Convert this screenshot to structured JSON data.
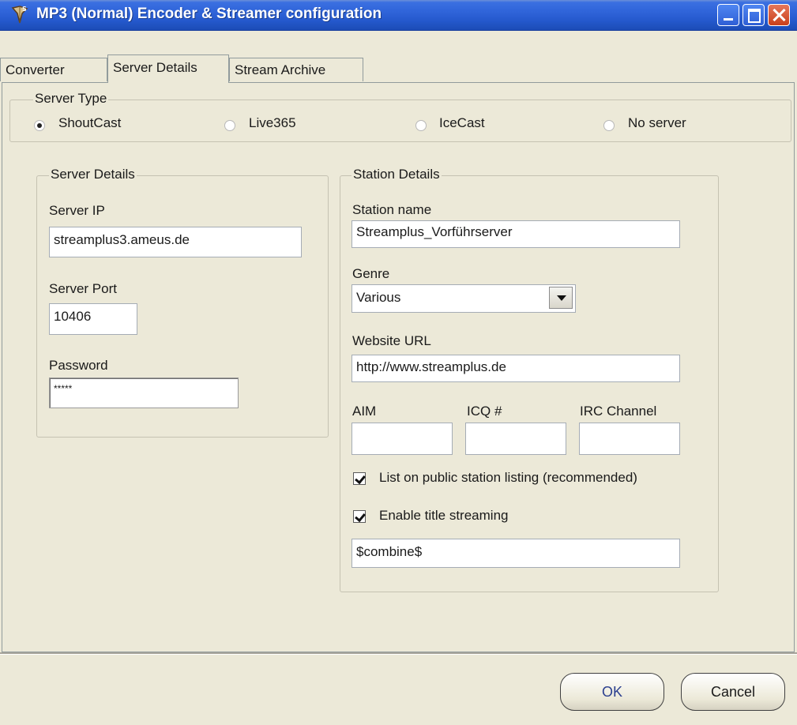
{
  "window": {
    "title": "MP3 (Normal) Encoder & Streamer configuration",
    "accent_color": "#2458cc",
    "close_color": "#c9401b"
  },
  "tabs": [
    {
      "label": "Converter",
      "active": false
    },
    {
      "label": "Server Details",
      "active": true
    },
    {
      "label": "Stream Archive",
      "active": false
    }
  ],
  "server_type": {
    "legend": "Server Type",
    "options": [
      {
        "label": "ShoutCast",
        "selected": true
      },
      {
        "label": "Live365",
        "selected": false
      },
      {
        "label": "IceCast",
        "selected": false
      },
      {
        "label": "No server",
        "selected": false
      }
    ]
  },
  "server_details": {
    "legend": "Server Details",
    "ip_label": "Server IP",
    "ip_value": "streamplus3.ameus.de",
    "port_label": "Server Port",
    "port_value": "10406",
    "password_label": "Password",
    "password_value": "*****"
  },
  "station_details": {
    "legend": "Station Details",
    "name_label": "Station name",
    "name_value": "Streamplus_Vorführserver",
    "genre_label": "Genre",
    "genre_value": "Various",
    "website_label": "Website URL",
    "website_value": "http://www.streamplus.de",
    "aim_label": "AIM",
    "aim_value": "",
    "icq_label": "ICQ #",
    "icq_value": "",
    "irc_label": "IRC Channel",
    "irc_value": "",
    "public_listing_label": "List on public station listing (recommended)",
    "public_listing_checked": true,
    "title_streaming_label": "Enable title streaming",
    "title_streaming_checked": true,
    "title_format_value": "$combine$"
  },
  "buttons": {
    "ok": "OK",
    "cancel": "Cancel"
  }
}
